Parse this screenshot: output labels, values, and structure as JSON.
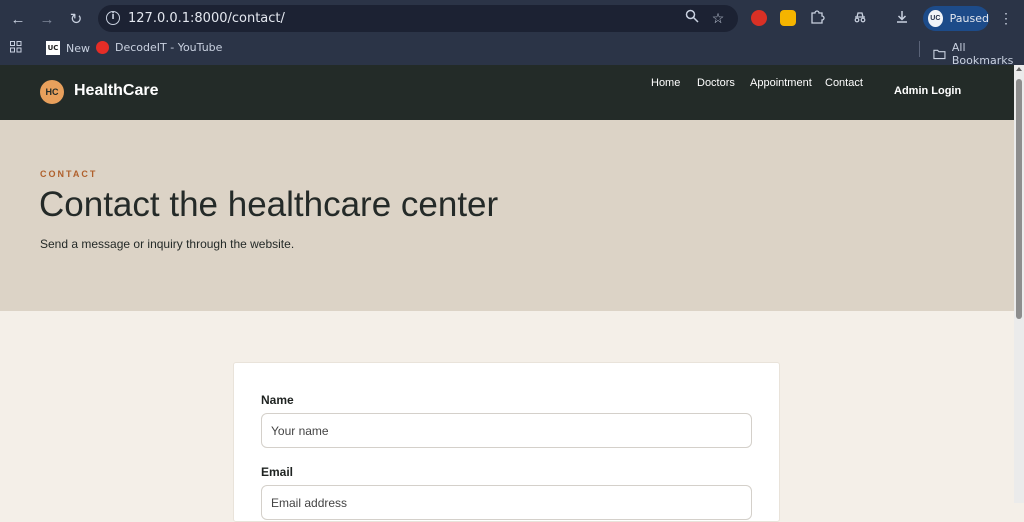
{
  "browser": {
    "url": "127.0.0.1:8000/contact/",
    "profile_status": "Paused",
    "profile_initials": "UC",
    "bookmarks": [
      {
        "label": "New"
      },
      {
        "label": "DecodeIT - YouTube"
      }
    ],
    "all_bookmarks": "All Bookmarks"
  },
  "header": {
    "logo_initials": "HC",
    "brand": "HealthCare",
    "nav": [
      "Home",
      "Doctors",
      "Appointment",
      "Contact"
    ],
    "admin_login": "Admin Login"
  },
  "hero": {
    "eyebrow": "CONTACT",
    "title": "Contact the healthcare center",
    "subtitle": "Send a message or inquiry through the website."
  },
  "form": {
    "name_label": "Name",
    "name_placeholder": "Your name",
    "email_label": "Email",
    "email_placeholder": "Email address"
  },
  "colors": {
    "header_bg": "#232b28",
    "hero_bg": "#dcd3c6",
    "page_bg": "#f4efe8",
    "accent": "#b0602c",
    "logo": "#e8a05c"
  }
}
